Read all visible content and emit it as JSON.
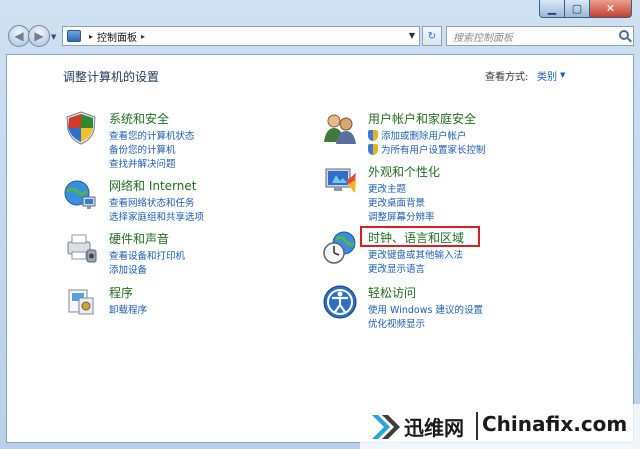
{
  "window": {
    "caption_min": "▁",
    "caption_max": "▢",
    "caption_close": "✕"
  },
  "nav": {
    "breadcrumb": "控制面板",
    "search_placeholder": "搜索控制面板"
  },
  "header": {
    "title": "调整计算机的设置",
    "view_by_label": "查看方式:",
    "view_by_value": "类别"
  },
  "categories": [
    {
      "heading": "系统和安全",
      "links": [
        "查看您的计算机状态",
        "备份您的计算机",
        "查找并解决问题"
      ]
    },
    {
      "heading": "网络和 Internet",
      "links": [
        "查看网络状态和任务",
        "选择家庭组和共享选项"
      ]
    },
    {
      "heading": "硬件和声音",
      "links": [
        "查看设备和打印机",
        "添加设备"
      ]
    },
    {
      "heading": "程序",
      "links": [
        "卸载程序"
      ]
    },
    {
      "heading": "用户帐户和家庭安全",
      "links": [
        "添加或删除用户帐户",
        "为所有用户设置家长控制"
      ]
    },
    {
      "heading": "外观和个性化",
      "links": [
        "更改主题",
        "更改桌面背景",
        "调整屏幕分辨率"
      ]
    },
    {
      "heading": "时钟、语言和区域",
      "links": [
        "更改键盘或其他输入法",
        "更改显示语言"
      ]
    },
    {
      "heading": "轻松访问",
      "links": [
        "使用 Windows 建议的设置",
        "优化视频显示"
      ]
    }
  ],
  "watermark": {
    "cn": "迅维网",
    "en": "Chinafix.com"
  },
  "colors": {
    "heading_green": "#1f6f1f",
    "link_blue": "#1a5fb8",
    "highlight_red": "#d32020"
  }
}
